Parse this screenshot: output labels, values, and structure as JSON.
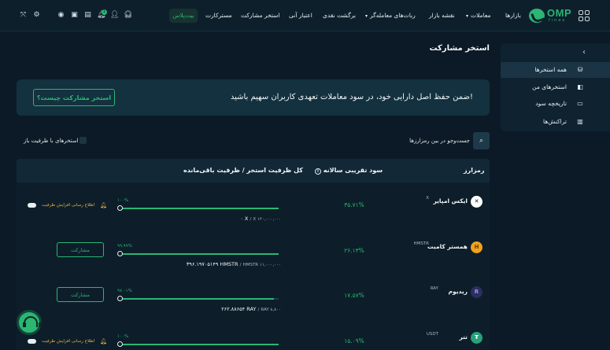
{
  "nav": {
    "brand": "OMP",
    "brand_sub": "finex",
    "items": [
      {
        "label": "بازارها",
        "caret": false
      },
      {
        "label": "معاملات",
        "caret": true
      },
      {
        "label": "نقشه بازار",
        "caret": false
      },
      {
        "label": "ربات‌های معامله‌گر",
        "caret": true
      },
      {
        "label": "برگشت نقدی",
        "caret": false
      },
      {
        "label": "اعتبار آنی",
        "caret": false
      },
      {
        "label": "استخر مشارکت",
        "caret": false
      },
      {
        "label": "مسترکارت",
        "caret": false
      }
    ],
    "highlight": "بیت‌پلاس",
    "notification_count": "1"
  },
  "page": {
    "title": "استخر مشارکت"
  },
  "sidebar": {
    "items": [
      {
        "label": "همه استخرها",
        "icon": "coins-icon",
        "active": true
      },
      {
        "label": "استخرهای من",
        "icon": "box-icon",
        "active": false
      },
      {
        "label": "تاریخچه سود",
        "icon": "wallet-icon",
        "active": false
      },
      {
        "label": "تراکنش‌ها",
        "icon": "trash-icon",
        "active": false
      }
    ]
  },
  "banner": {
    "text": "ضمن حفظ اصل دارایی خود، در سود معاملات تعهدی کاربران سهیم باشید!",
    "button": "استخر مشارکت چیست؟"
  },
  "filter": {
    "search_placeholder": "جست‌وجو در بین رمزارزها",
    "open_only": "استخرهای با ظرفیت باز"
  },
  "table": {
    "headers": {
      "coin": "رمزارز",
      "apr": "سود تقریبی سالانه",
      "capacity": "کل ظرفیت استخر / ظرفیت باقی‌مانده"
    },
    "rows": [
      {
        "name": "ایکس امپایر",
        "symbol": "X",
        "apr": "۳۵.۷۱%",
        "progress_label": "۱۰۰%",
        "progress": 1.0,
        "total": "X ۱۲۰,۰۰۰,۰۰۰",
        "remaining": "۰ X",
        "action": "notify",
        "notify_text": "اطلاع رسانی افزایش ظرفیت",
        "logo_text": "✕",
        "logo_bg": "#ffffff",
        "logo_fg": "#111111"
      },
      {
        "name": "همستر کامبت",
        "symbol": "HMSTR",
        "apr": "۲۶.۱۳%",
        "progress_label": "۹۹.۹۹%",
        "progress": 0.9999,
        "total": "HMSTR ۱۱,۰۰۰,۰۰۰",
        "remaining": "۳۹۶.۱۹۷۰۵۱۴۹ HMSTR",
        "action": "stake",
        "stake_text": "مشارکت",
        "logo_text": "H",
        "logo_bg": "#f0a21b",
        "logo_fg": "#6b3a00"
      },
      {
        "name": "ریدیوم",
        "symbol": "RAY",
        "apr": "۱۷.۵۷%",
        "progress_label": "۹۷.۰۱%",
        "progress": 0.9701,
        "total": "RAY ۸,۸۰۰",
        "remaining": "۲۶۲.۸۸۶۵۴ RAY",
        "action": "stake",
        "stake_text": "مشارکت",
        "logo_text": "R",
        "logo_bg": "#2a2f5e",
        "logo_fg": "#9b8cff"
      },
      {
        "name": "تتر",
        "symbol": "USDT",
        "apr": "۱۵.۰۹%",
        "progress_label": "۱۰۰%",
        "progress": 1.0,
        "total": "",
        "remaining": "",
        "action": "notify",
        "notify_text": "اطلاع رسانی افزایش ظرفیت",
        "logo_text": "₮",
        "logo_bg": "#26a17b",
        "logo_fg": "#ffffff"
      }
    ]
  }
}
